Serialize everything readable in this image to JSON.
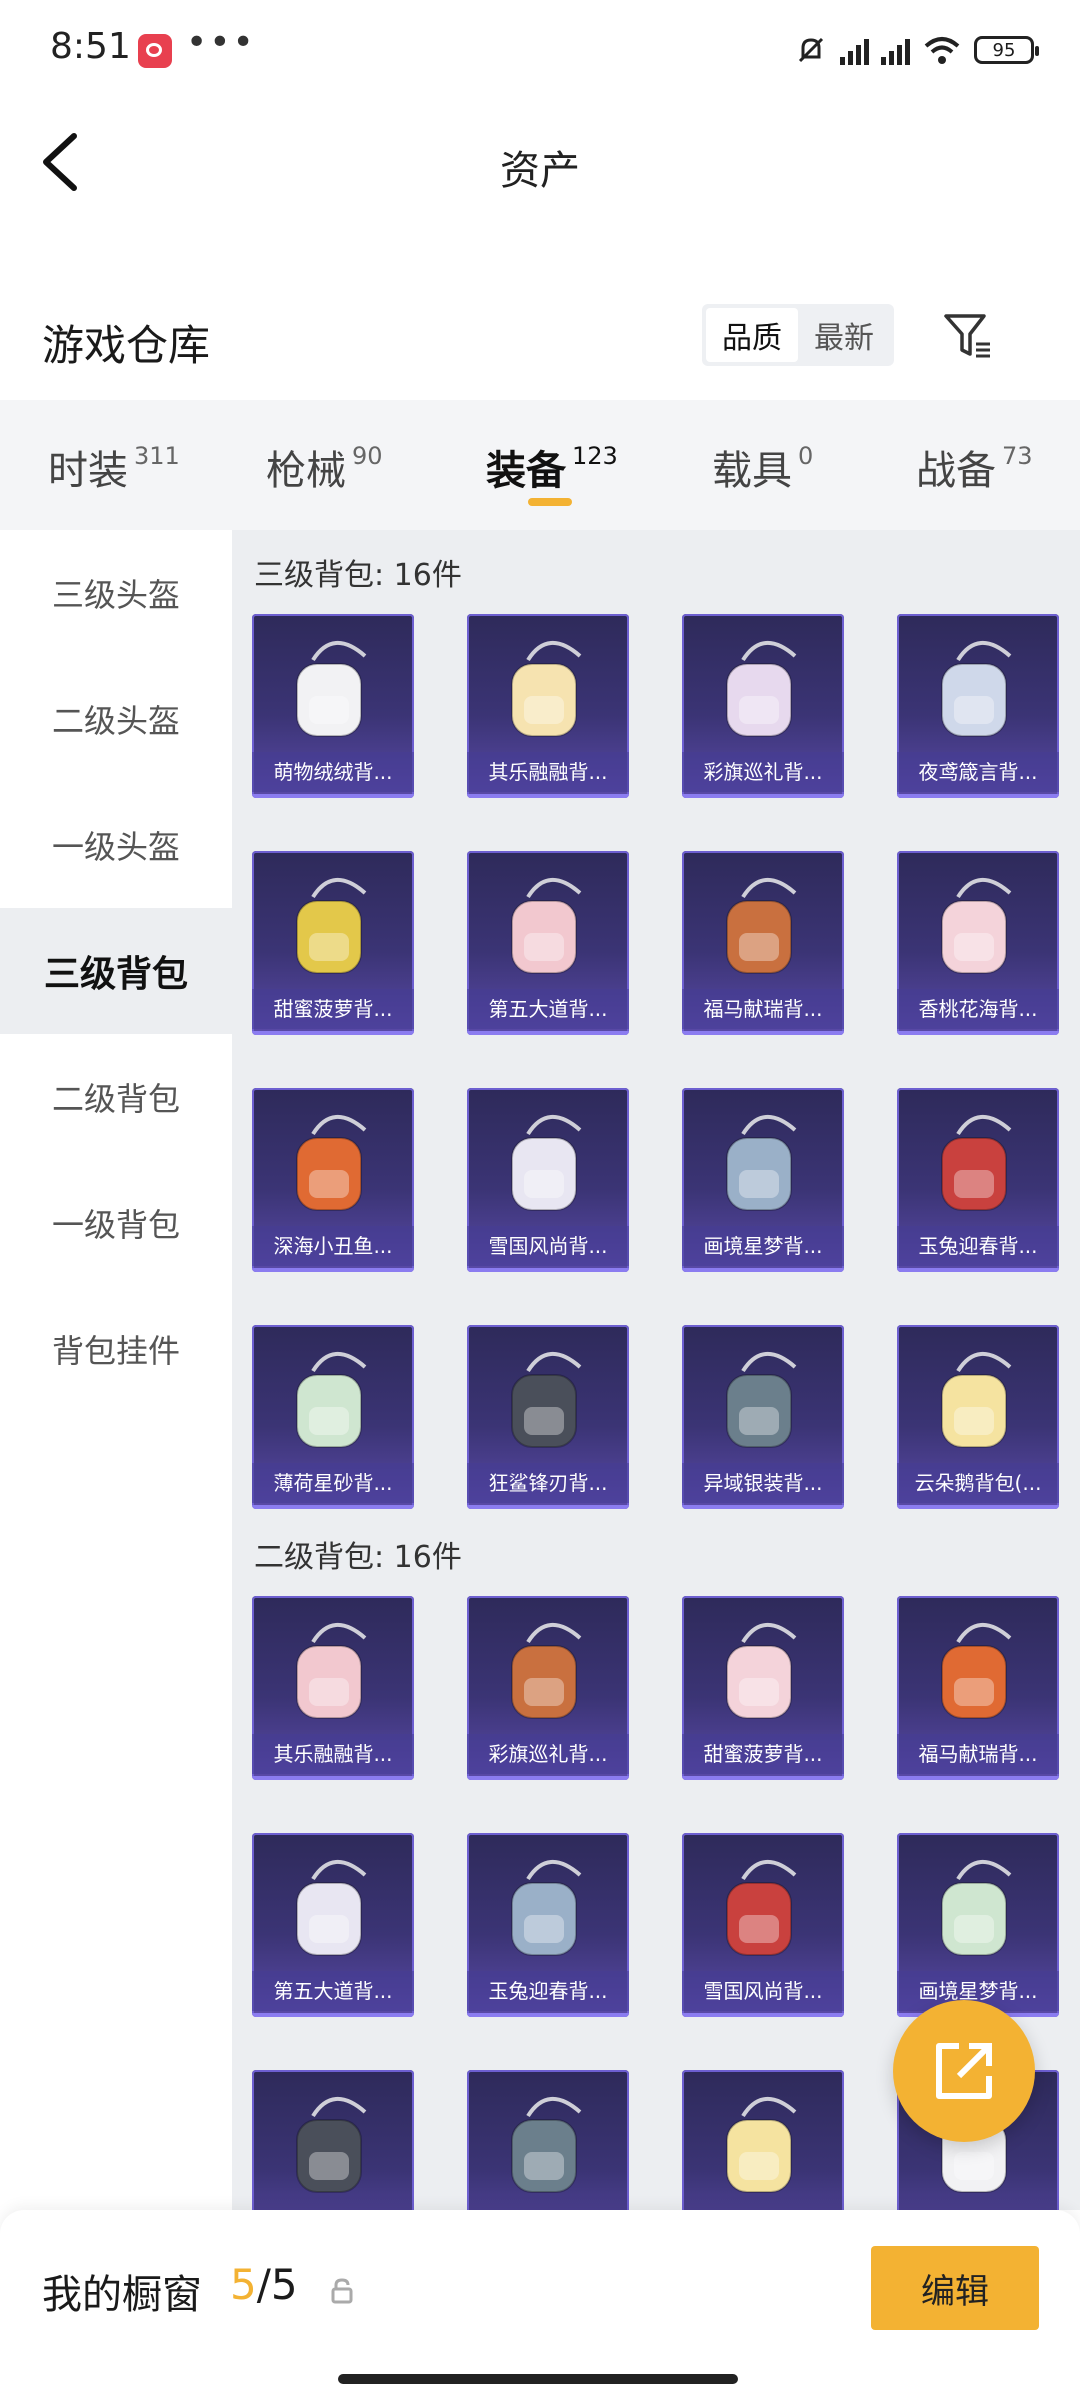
{
  "status": {
    "time": "8:51",
    "dots": "•••",
    "battery": "95"
  },
  "nav": {
    "title": "资产"
  },
  "warehouse": {
    "title": "游戏仓库",
    "sort_quality": "品质",
    "sort_latest": "最新"
  },
  "tabs": [
    {
      "label": "时装",
      "count": "311"
    },
    {
      "label": "枪械",
      "count": "90"
    },
    {
      "label": "装备",
      "count": "123"
    },
    {
      "label": "载具",
      "count": "0"
    },
    {
      "label": "战备",
      "count": "73"
    }
  ],
  "sidebar": [
    "三级头盔",
    "二级头盔",
    "一级头盔",
    "三级背包",
    "二级背包",
    "一级背包",
    "背包挂件"
  ],
  "groups": [
    {
      "title": "三级背包: 16件",
      "items": [
        "萌物绒绒背...",
        "其乐融融背...",
        "彩旗巡礼背...",
        "夜鸢箴言背...",
        "甜蜜菠萝背...",
        "第五大道背...",
        "福马献瑞背...",
        "香桃花海背...",
        "深海小丑鱼...",
        "雪国风尚背...",
        "画境星梦背...",
        "玉兔迎春背...",
        "薄荷星砂背...",
        "狂鲨锋刃背...",
        "异域银装背...",
        "云朵鹅背包(..."
      ]
    },
    {
      "title": "二级背包: 16件",
      "items": [
        "其乐融融背...",
        "彩旗巡礼背...",
        "甜蜜菠萝背...",
        "福马献瑞背...",
        "第五大道背...",
        "玉兔迎春背...",
        "雪国风尚背...",
        "画境星梦背...",
        "",
        "",
        "",
        ""
      ]
    }
  ],
  "bottom": {
    "label": "我的橱窗",
    "count_a": "5",
    "count_b": "/5",
    "edit": "编辑"
  },
  "colors": {
    "accent": "#f3b233",
    "card_bg": "#3b3475"
  }
}
